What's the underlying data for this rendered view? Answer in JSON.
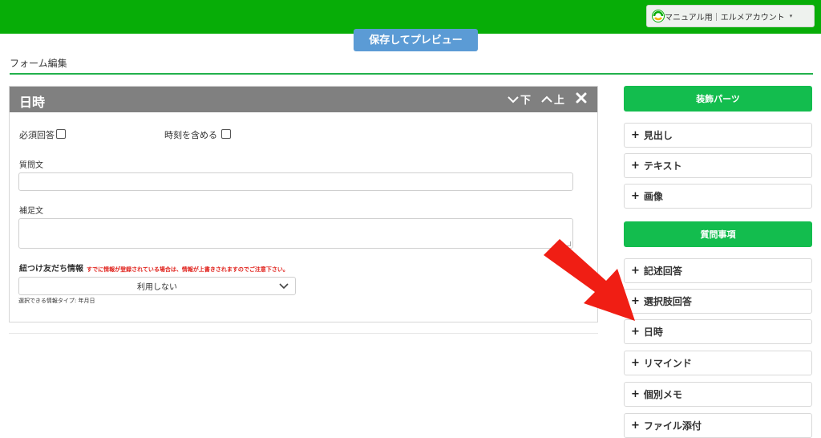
{
  "header": {
    "account_label": "マニュアル用｜エルメアカウント",
    "account_caret": "▾",
    "brand_color": "#07ad07"
  },
  "toolbar": {
    "save_preview_label": "保存してプレビュー"
  },
  "page": {
    "title": "フォーム編集"
  },
  "panel": {
    "title": "日時",
    "move_down_label": "下",
    "move_up_label": "上",
    "required_label": "必須回答",
    "include_time_label": "時刻を含める",
    "question_label": "質問文",
    "question_value": "",
    "supplement_label": "補足文",
    "supplement_value": "",
    "friend_info_label": "紐つけ友だち情報",
    "friend_info_note": "すでに情報が登録されている場合は、情報が上書きされますのでご注意下さい。",
    "friend_info_select_value": "利用しない",
    "selectable_type_note": "選択できる情報タイプ:  年月日"
  },
  "sidebar": {
    "decoration_header": "装飾パーツ",
    "decoration_items": [
      {
        "label": "見出し"
      },
      {
        "label": "テキスト"
      },
      {
        "label": "画像"
      }
    ],
    "question_header": "質問事項",
    "question_items": [
      {
        "label": "記述回答"
      },
      {
        "label": "選択肢回答"
      },
      {
        "label": "日時"
      },
      {
        "label": "リマインド"
      },
      {
        "label": "個別メモ"
      },
      {
        "label": "ファイル添付"
      }
    ],
    "plus_glyph": "+",
    "accent_color": "#13bd4e"
  },
  "annotation": {
    "arrow_color": "#f01e14",
    "points_to": "日時"
  }
}
